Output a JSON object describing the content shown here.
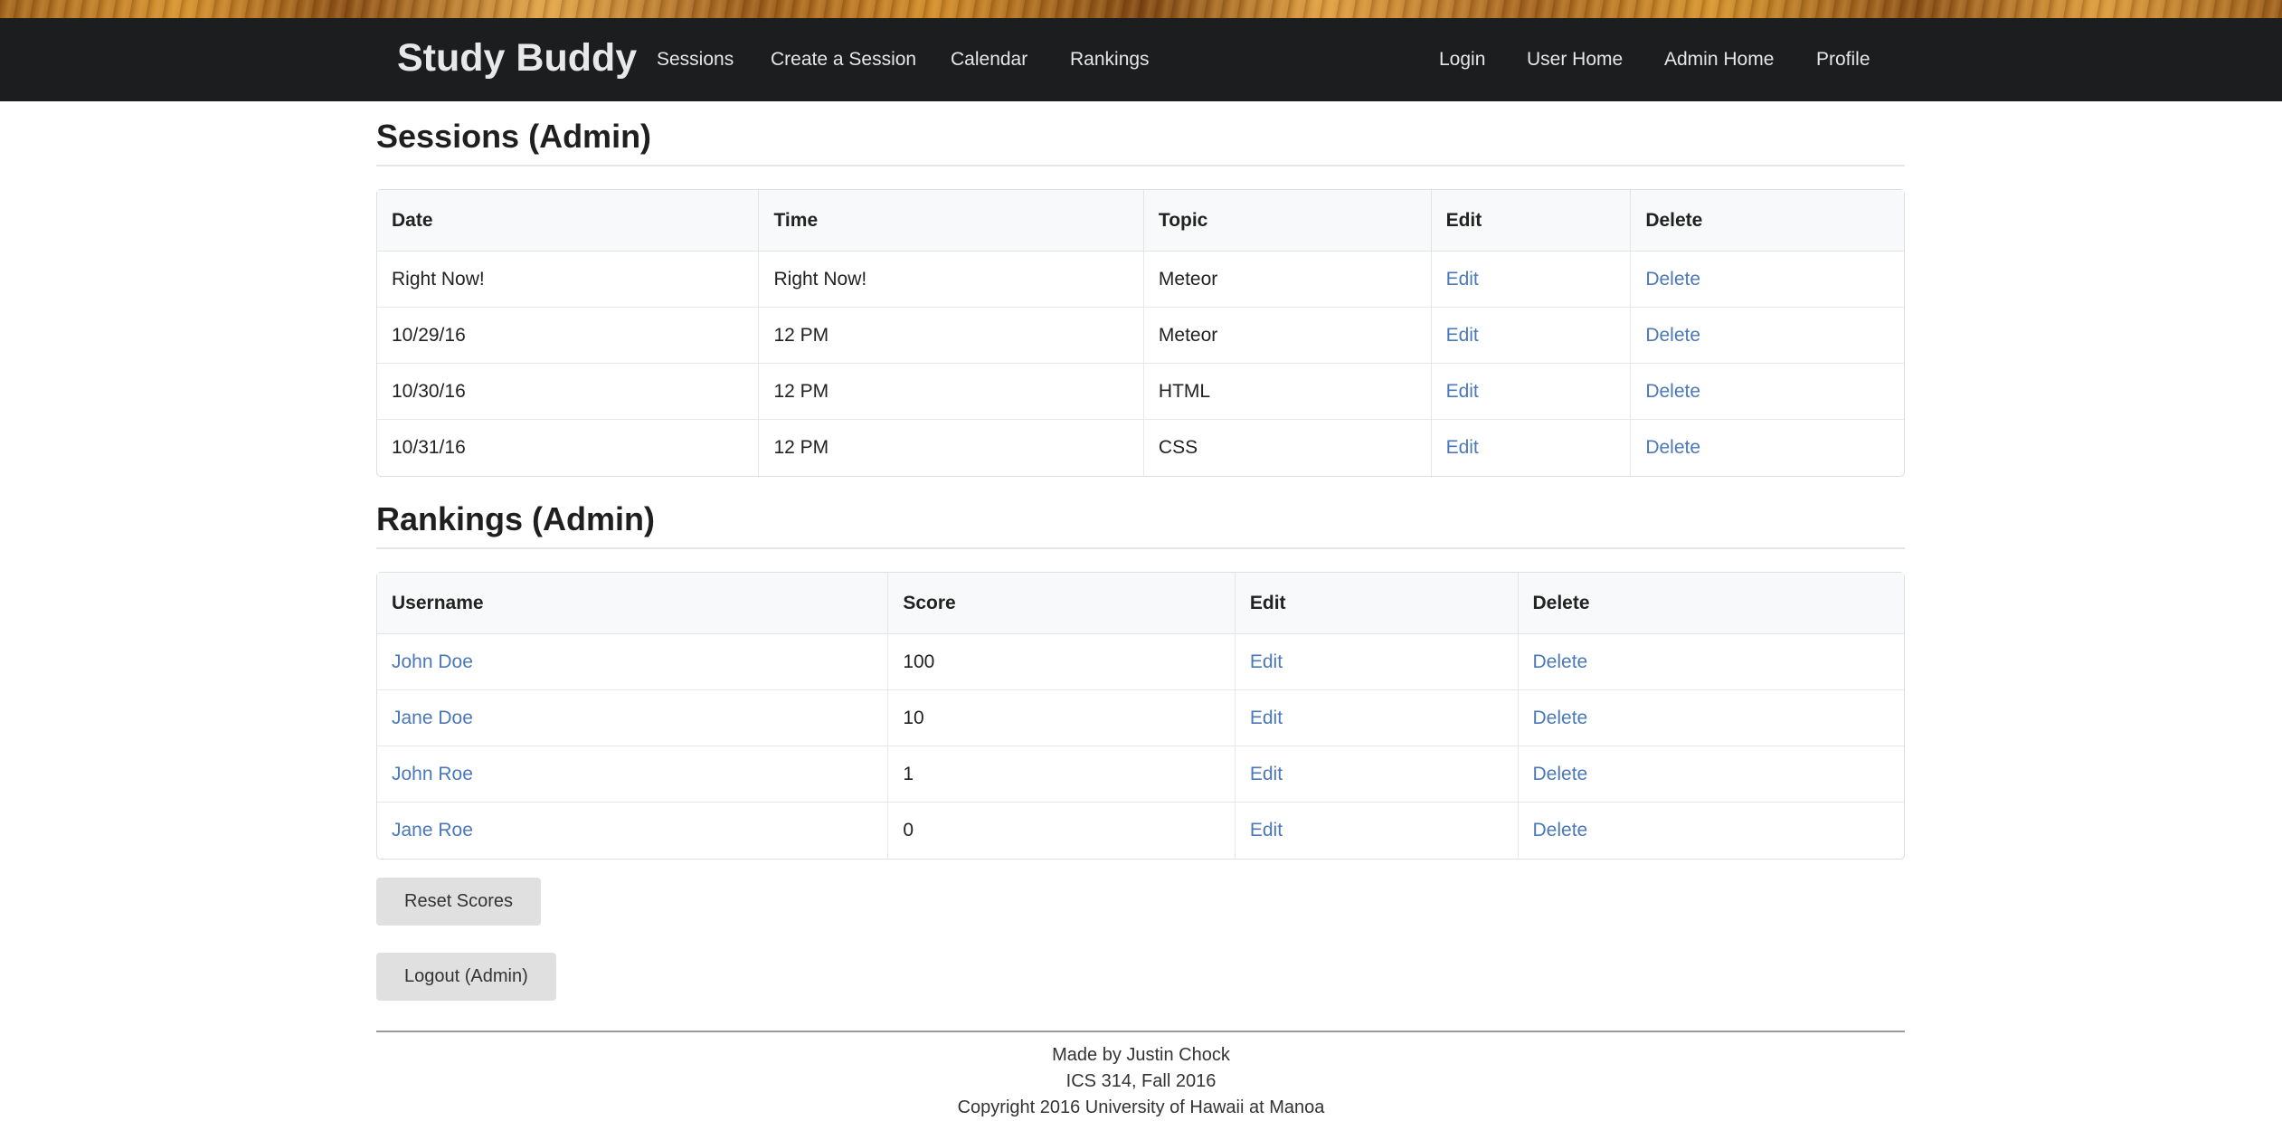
{
  "navbar": {
    "brand": "Study Buddy",
    "left_links": [
      "Sessions",
      "Create a Session",
      "Calendar",
      "Rankings"
    ],
    "right_links": [
      "Login",
      "User Home",
      "Admin Home",
      "Profile"
    ]
  },
  "sessions": {
    "title": "Sessions (Admin)",
    "headers": [
      "Date",
      "Time",
      "Topic",
      "Edit",
      "Delete"
    ],
    "rows": [
      {
        "date": "Right Now!",
        "time": "Right Now!",
        "topic": "Meteor",
        "edit": "Edit",
        "delete": "Delete"
      },
      {
        "date": "10/29/16",
        "time": "12 PM",
        "topic": "Meteor",
        "edit": "Edit",
        "delete": "Delete"
      },
      {
        "date": "10/30/16",
        "time": "12 PM",
        "topic": "HTML",
        "edit": "Edit",
        "delete": "Delete"
      },
      {
        "date": "10/31/16",
        "time": "12 PM",
        "topic": "CSS",
        "edit": "Edit",
        "delete": "Delete"
      }
    ]
  },
  "rankings": {
    "title": "Rankings (Admin)",
    "headers": [
      "Username",
      "Score",
      "Edit",
      "Delete"
    ],
    "rows": [
      {
        "username": "John Doe",
        "score": "100",
        "edit": "Edit",
        "delete": "Delete"
      },
      {
        "username": "Jane Doe",
        "score": "10",
        "edit": "Edit",
        "delete": "Delete"
      },
      {
        "username": "John Roe",
        "score": "1",
        "edit": "Edit",
        "delete": "Delete"
      },
      {
        "username": "Jane Roe",
        "score": "0",
        "edit": "Edit",
        "delete": "Delete"
      }
    ]
  },
  "buttons": {
    "reset_scores": "Reset Scores",
    "logout": "Logout (Admin)"
  },
  "footer": {
    "line1": "Made by Justin Chock",
    "line2": "ICS 314, Fall 2016",
    "line3": "Copyright 2016 University of Hawaii at Manoa"
  },
  "colors": {
    "navbar_bg": "#1c1d1f",
    "link": "#4a78b8",
    "button_bg": "#e0e0e0"
  }
}
